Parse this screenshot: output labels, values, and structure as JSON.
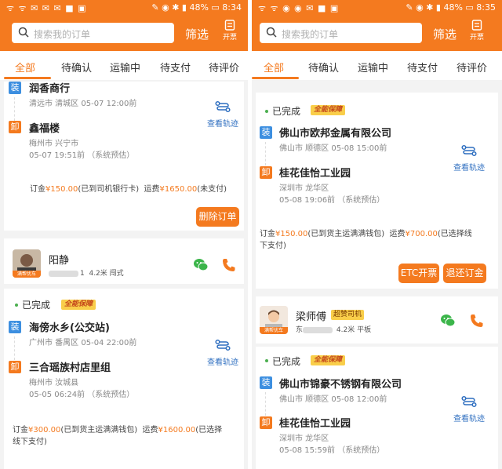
{
  "left": {
    "status": {
      "icons": "ᯤ ᯤ ✉ ✉ ✉ ■ ▣",
      "right": "✎ ◉ ✱ ▮ 48% ▭ 8:34"
    },
    "search": {
      "placeholder": "搜索我的订单"
    },
    "filter_label": "筛选",
    "invoice_label": "开票",
    "tabs": [
      "全部",
      "待确认",
      "运输中",
      "待支付",
      "待评价"
    ],
    "order1": {
      "load_place": "润香商行",
      "load_sub": "清远市 清城区    05-07 12:00前",
      "unload_place": "鑫福楼",
      "unload_sub1": "梅州市 兴宁市",
      "unload_sub2": "05-07 19:51前    （系统预估）",
      "track_label": "查看轨迹",
      "deposit_prefix": "订金",
      "deposit_amount": "¥150.00",
      "deposit_note": "(已到司机银行卡)",
      "freight_prefix": "运费",
      "freight_amount": "¥1650.00",
      "freight_note": "(未支付)",
      "delete_button": "删除订单"
    },
    "driver": {
      "name": "阳静",
      "sub": "4.2米 闯式",
      "masked_suffix": "1",
      "avatar_tag": "满帮优车"
    },
    "order2": {
      "status": "已完成",
      "badge": "全能保障",
      "load_place": "海傍水乡(公交站)",
      "load_sub": "广州市 番禺区    05-04 22:00前",
      "unload_place": "三合瑶族村店里组",
      "unload_sub1": "梅州市 汝城县",
      "unload_sub2": "05-05 06:24前    （系统预估）",
      "track_label": "查看轨迹",
      "deposit_prefix": "订金",
      "deposit_amount": "¥300.00",
      "deposit_note": "(已到货主运满满钱包)",
      "freight_prefix": "运费",
      "freight_amount": "¥1600.00",
      "freight_note": "(已选择",
      "freight_note2": "线下支付)"
    }
  },
  "right": {
    "status": {
      "icons": "ᯤ ᯤ ◉ ◉ ✉ ■ ▣",
      "right": "✎ ◉ ✱ ▮ 48% ▭ 8:35"
    },
    "search": {
      "placeholder": "搜索我的订单"
    },
    "filter_label": "筛选",
    "invoice_label": "开票",
    "tabs": [
      "全部",
      "待确认",
      "运输中",
      "待支付",
      "待评价"
    ],
    "order1": {
      "status": "已完成",
      "badge": "全能保障",
      "load_place": "佛山市欧邦金属有限公司",
      "load_sub": "佛山市 顺德区    05-08 15:00前",
      "unload_place": "桂花佳怡工业园",
      "unload_sub1": "深圳市 龙华区",
      "unload_sub2": "05-08 19:06前    （系统预估）",
      "track_label": "查看轨迹",
      "deposit_prefix": "订金",
      "deposit_amount": "¥150.00",
      "deposit_note": "(已到货主运满满钱包)",
      "freight_prefix": "运费",
      "freight_amount": "¥700.00",
      "freight_note": "(已选择线",
      "freight_note2": "下支付)",
      "etc_button": "ETC开票",
      "refund_button": "退还订金"
    },
    "driver": {
      "name": "梁师傅",
      "super_tag": "超赞司机",
      "sub": "4.2米 平板",
      "masked_prefix": "东",
      "avatar_tag": "满帮优车"
    },
    "order2": {
      "status": "已完成",
      "badge": "全能保障",
      "load_place": "佛山市锦豪不锈钢有限公司",
      "load_sub": "佛山市 顺德区    05-08 12:00前",
      "unload_place": "桂花佳怡工业园",
      "unload_sub1": "深圳市 龙华区",
      "unload_sub2": "05-08 15:59前    （系统预估）",
      "track_label": "查看轨迹"
    }
  },
  "badge_load": "装",
  "badge_unload": "卸",
  "colors": {
    "brand": "#f47a1f",
    "load": "#3d8fe0",
    "wechat": "#3bb54a",
    "link": "#2f6fc0"
  }
}
